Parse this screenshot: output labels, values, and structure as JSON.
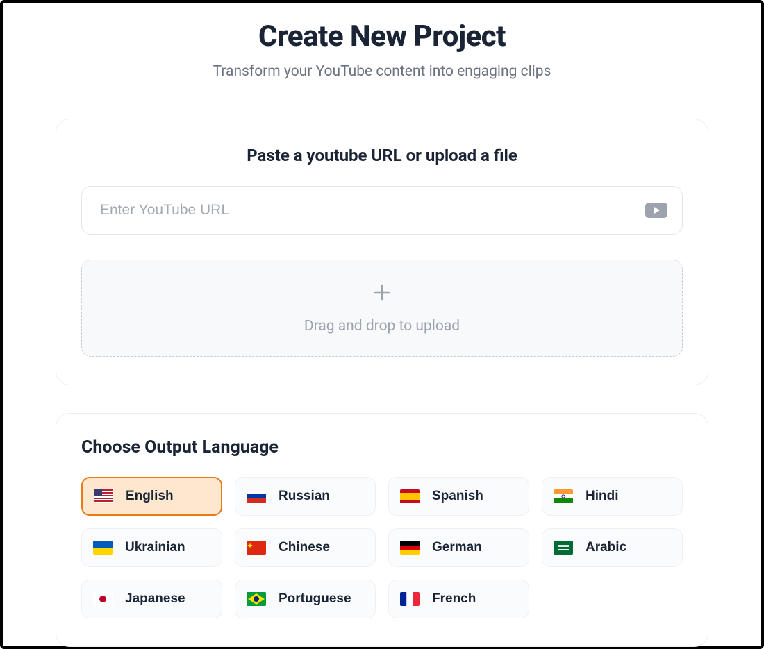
{
  "header": {
    "title": "Create New Project",
    "subtitle": "Transform your YouTube content into engaging clips"
  },
  "input_section": {
    "heading": "Paste a youtube URL or upload a file",
    "url_placeholder": "Enter YouTube URL",
    "url_value": "",
    "dropzone_text": "Drag and drop to upload"
  },
  "language_section": {
    "heading": "Choose Output Language",
    "selected": "english",
    "options": [
      {
        "id": "english",
        "label": "English"
      },
      {
        "id": "russian",
        "label": "Russian"
      },
      {
        "id": "spanish",
        "label": "Spanish"
      },
      {
        "id": "hindi",
        "label": "Hindi"
      },
      {
        "id": "ukrainian",
        "label": "Ukrainian"
      },
      {
        "id": "chinese",
        "label": "Chinese"
      },
      {
        "id": "german",
        "label": "German"
      },
      {
        "id": "arabic",
        "label": "Arabic"
      },
      {
        "id": "japanese",
        "label": "Japanese"
      },
      {
        "id": "portuguese",
        "label": "Portuguese"
      },
      {
        "id": "french",
        "label": "French"
      }
    ]
  }
}
